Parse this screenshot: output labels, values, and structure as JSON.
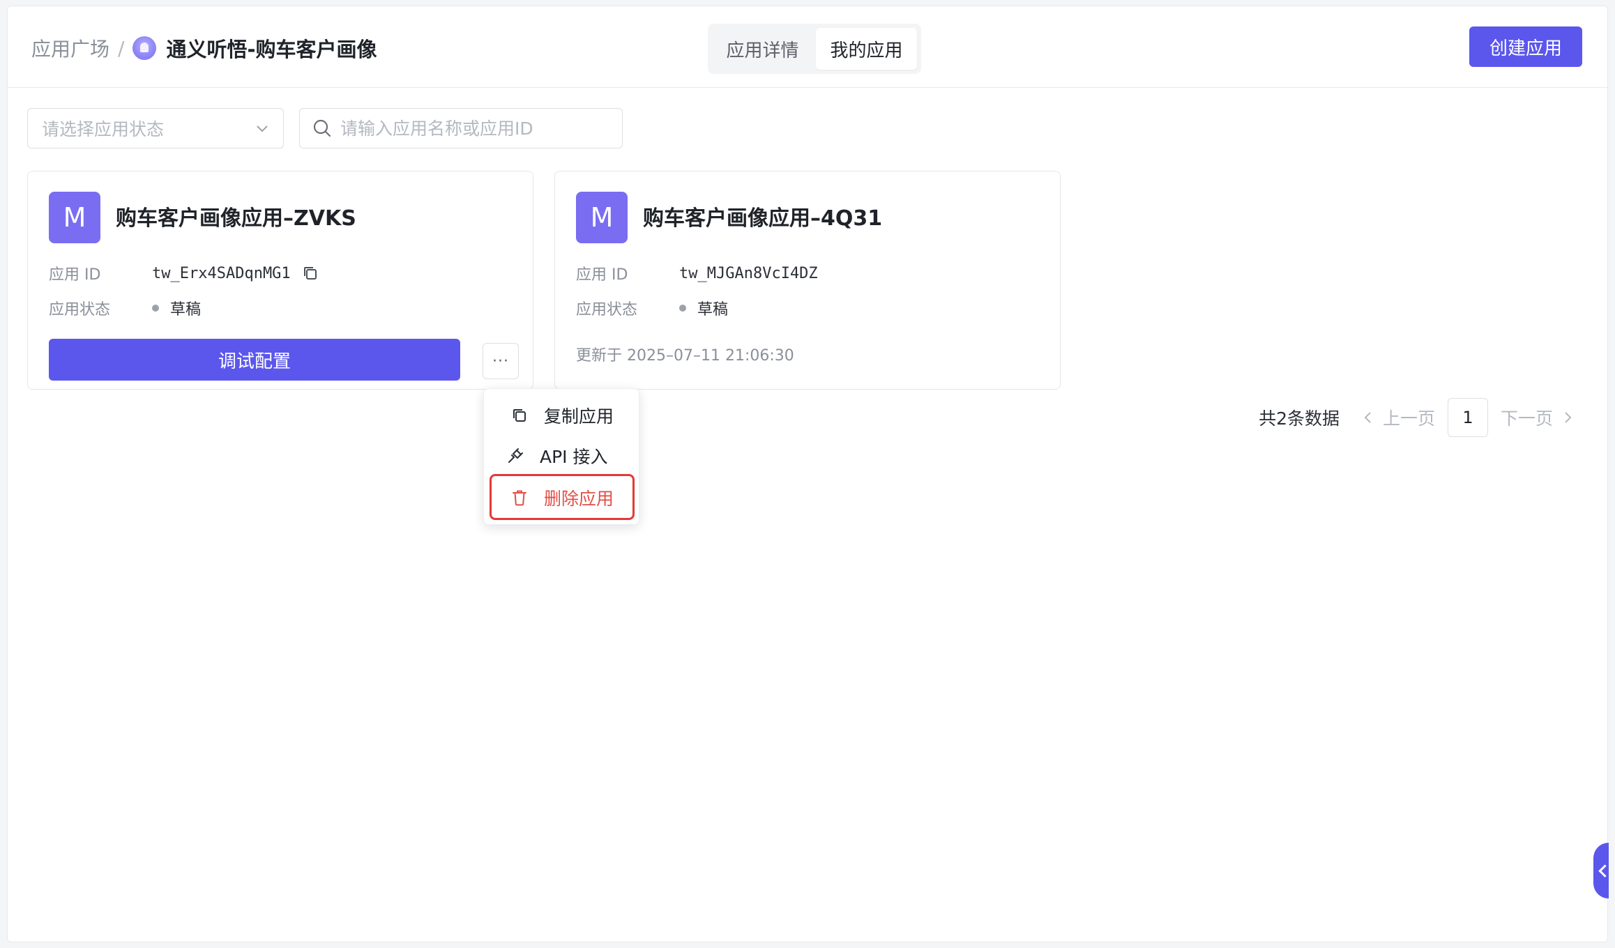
{
  "header": {
    "breadcrumb_root": "应用广场",
    "breadcrumb_separator": "/",
    "app_name": "通义听悟-购车客户画像",
    "tabs": [
      {
        "label": "应用详情",
        "active": false
      },
      {
        "label": "我的应用",
        "active": true
      }
    ],
    "create_button": "创建应用"
  },
  "filters": {
    "status_placeholder": "请选择应用状态",
    "search_placeholder": "请输入应用名称或应用ID"
  },
  "cards": [
    {
      "avatar": "M",
      "title": "购车客户画像应用–ZVKS",
      "id_label": "应用 ID",
      "id_value": "tw_Erx4SADqnMG1",
      "status_label": "应用状态",
      "status_value": "草稿",
      "debug_button": "调试配置",
      "more_button": "···"
    },
    {
      "avatar": "M",
      "title": "购车客户画像应用–4Q31",
      "id_label": "应用 ID",
      "id_value": "tw_MJGAn8VcI4DZ",
      "status_label": "应用状态",
      "status_value": "草稿",
      "updated": "更新于  2025–07–11 21:06:30"
    }
  ],
  "dropdown_menu": {
    "items": [
      {
        "label": "复制应用",
        "icon": "copy-icon"
      },
      {
        "label": "API 接入",
        "icon": "plug-icon"
      },
      {
        "label": "删除应用",
        "icon": "trash-icon",
        "danger_color": "#e34d45"
      }
    ]
  },
  "pagination": {
    "total": "共2条数据",
    "prev": "上一页",
    "current": "1",
    "next": "下一页"
  },
  "colors": {
    "accent": "#5b57ec",
    "danger": "#e34d45"
  }
}
